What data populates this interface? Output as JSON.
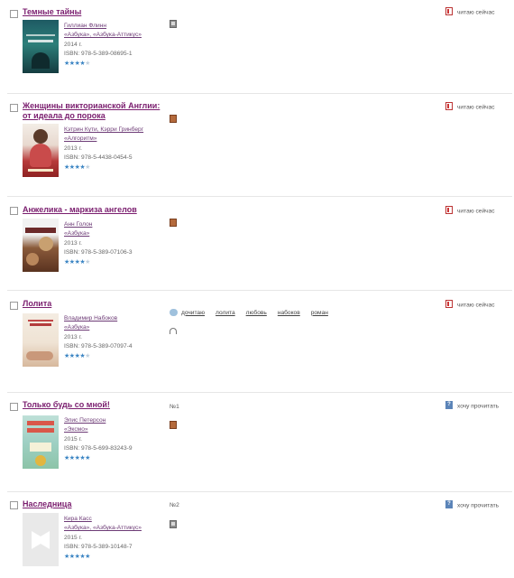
{
  "books": [
    {
      "title": "Темные тайны",
      "author": "Гиллиан Флинн",
      "publisher": "«Азбука», «Азбука-Аттикус»",
      "year": "2014 г.",
      "isbn": "ISBN: 978-5-389-08695-1",
      "rating": 4,
      "format_icon": "ebook-icon",
      "status": "читаю сейчас",
      "status_icon": "reading-book-icon"
    },
    {
      "title": "Женщины викторианской Англии: от идеала до порока",
      "title_line1": "Женщины викторианской Англии:",
      "title_line2": "от идеала до порока",
      "author": "Кэтрин Кути, Кэрри Гринберг",
      "publisher": "«Алгоритм»",
      "year": "2013 г.",
      "isbn": "ISBN: 978-5-4438-0454-5",
      "rating": 4,
      "format_icon": "paper-book-icon",
      "status": "читаю сейчас",
      "status_icon": "reading-book-icon"
    },
    {
      "title": "Анжелика - маркиза ангелов",
      "author": "Анн Голон",
      "publisher": "«Азбука»",
      "year": "2013 г.",
      "isbn": "ISBN: 978-5-389-07106-3",
      "rating": 4,
      "format_icon": "paper-book-icon",
      "status": "читаю сейчас",
      "status_icon": "reading-book-icon"
    },
    {
      "title": "Лолита",
      "author": "Владимир Набоков",
      "publisher": "«Азбука»",
      "year": "2013 г.",
      "isbn": "ISBN: 978-5-389-07097-4",
      "rating": 4,
      "format_icon": "audiobook-icon",
      "tags": [
        "дочитаю",
        "лолита",
        "любовь",
        "набоков",
        "роман"
      ],
      "status": "читаю сейчас",
      "status_icon": "reading-book-icon"
    },
    {
      "title": "Только будь со мной!",
      "author": "Элис Петерсон",
      "publisher": "«Эксмо»",
      "year": "2015 г.",
      "isbn": "ISBN: 978-5-699-83243-9",
      "rating": 5,
      "number": "№1",
      "format_icon": "paper-book-icon",
      "status": "хочу прочитать",
      "status_icon": "want-to-read-icon"
    },
    {
      "title": "Наследница",
      "author": "Кира Касс",
      "publisher": "«Азбука», «Азбука-Аттикус»",
      "year": "2015 г.",
      "isbn": "ISBN: 978-5-389-10148-7",
      "rating": 5,
      "number": "№2",
      "format_icon": "ebook-icon",
      "status": "хочу прочитать",
      "status_icon": "want-to-read-icon"
    }
  ],
  "colors": {
    "title_link": "#7a1d6e",
    "meta_link": "#6d3b76",
    "star": "#3d86c4",
    "divider": "#e6e6e6"
  }
}
